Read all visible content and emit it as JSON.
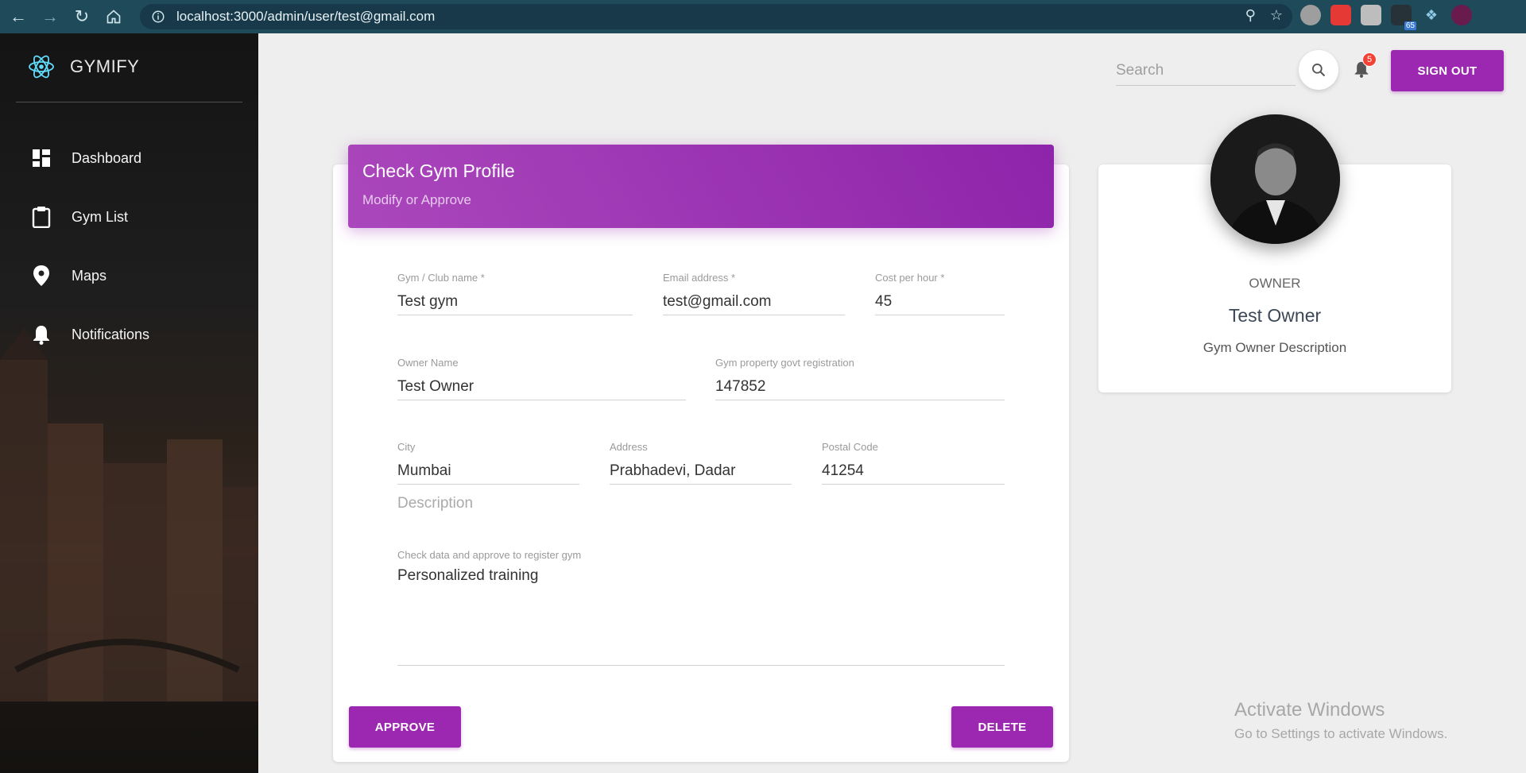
{
  "browser": {
    "url": "localhost:3000/admin/user/test@gmail.com",
    "extension_badge": "65"
  },
  "sidebar": {
    "brand": "GYMIFY",
    "items": [
      {
        "label": "Dashboard",
        "icon": "dashboard-icon"
      },
      {
        "label": "Gym List",
        "icon": "clipboard-icon"
      },
      {
        "label": "Maps",
        "icon": "location-pin-icon"
      },
      {
        "label": "Notifications",
        "icon": "bell-icon"
      }
    ]
  },
  "topbar": {
    "search_placeholder": "Search",
    "notification_count": "5",
    "signout_label": "SIGN OUT"
  },
  "form": {
    "title": "Check Gym Profile",
    "subtitle": "Modify or Approve",
    "gym_name": {
      "label": "Gym / Club name *",
      "value": "Test gym"
    },
    "email": {
      "label": "Email address *",
      "value": "test@gmail.com"
    },
    "cost": {
      "label": "Cost per hour *",
      "value": "45"
    },
    "owner_name": {
      "label": "Owner Name",
      "value": "Test Owner"
    },
    "registration": {
      "label": "Gym property govt registration",
      "value": "147852"
    },
    "city": {
      "label": "City",
      "value": "Mumbai"
    },
    "address": {
      "label": "Address",
      "value": "Prabhadevi, Dadar"
    },
    "postal": {
      "label": "Postal Code",
      "value": "41254"
    },
    "description_label": "Description",
    "textarea": {
      "label": "Check data and approve to register gym",
      "value": "Personalized training"
    },
    "approve_label": "APPROVE",
    "delete_label": "DELETE"
  },
  "profile": {
    "role": "OWNER",
    "name": "Test Owner",
    "description": "Gym Owner Description"
  },
  "watermark": {
    "line1": "Activate Windows",
    "line2": "Go to Settings to activate Windows."
  },
  "colors": {
    "accent": "#9c27b0",
    "browser_bar": "#1e4a5a",
    "badge": "#f44336"
  }
}
